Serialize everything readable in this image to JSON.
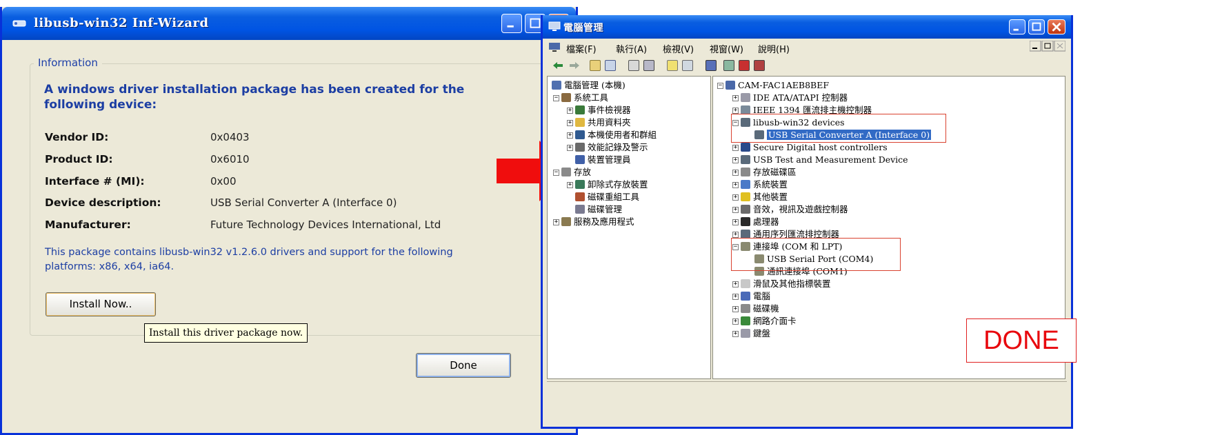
{
  "wizard": {
    "title": "libusb-win32 Inf-Wizard",
    "group_label": "Information",
    "headline": "A windows driver installation package has been created for the following device:",
    "fields": [
      {
        "label": "Vendor ID:",
        "value": "0x0403"
      },
      {
        "label": "Product ID:",
        "value": "0x6010"
      },
      {
        "label": "Interface # (MI):",
        "value": "0x00"
      },
      {
        "label": "Device description:",
        "value": "USB Serial Converter A (Interface 0)"
      },
      {
        "label": "Manufacturer:",
        "value": "Future Technology Devices International, Ltd"
      }
    ],
    "footnote": "This package contains libusb-win32 v1.2.6.0 drivers and support for the following platforms: x86, x64, ia64.",
    "install_button": "Install Now..",
    "tooltip": "Install this driver package now.",
    "done_button": "Done"
  },
  "arrow": {
    "color": "#f00d0d",
    "icon": "right-arrow-icon"
  },
  "computer_management": {
    "title": "電腦管理",
    "menu": [
      "檔案(F)",
      "執行(A)",
      "檢視(V)",
      "視窗(W)",
      "說明(H)"
    ],
    "left_tree": [
      "電腦管理 (本機)",
      "系統工具",
      "事件檢視器",
      "共用資料夾",
      "本機使用者和群組",
      "效能記錄及警示",
      "裝置管理員",
      "存放",
      "卸除式存放裝置",
      "磁碟重組工具",
      "磁碟管理",
      "服務及應用程式"
    ],
    "right_tree": [
      "CAM-FAC1AEB8BEF",
      "IDE ATA/ATAPI 控制器",
      "IEEE 1394 匯流排主機控制器",
      "libusb-win32 devices",
      "USB Serial Converter A (Interface 0)",
      "Secure Digital host controllers",
      "USB Test and Measurement Device",
      "存放磁碟區",
      "系統裝置",
      "其他裝置",
      "音效，視訊及遊戲控制器",
      "處理器",
      "通用序列匯流排控制器",
      "連接埠 (COM 和 LPT)",
      "USB Serial Port (COM4)",
      "通訊連接埠 (COM1)",
      "滑鼠及其他指標裝置",
      "電腦",
      "磁碟機",
      "網路介面卡",
      "鍵盤"
    ],
    "done_label": "DONE",
    "highlight_color": "#d9412e"
  }
}
